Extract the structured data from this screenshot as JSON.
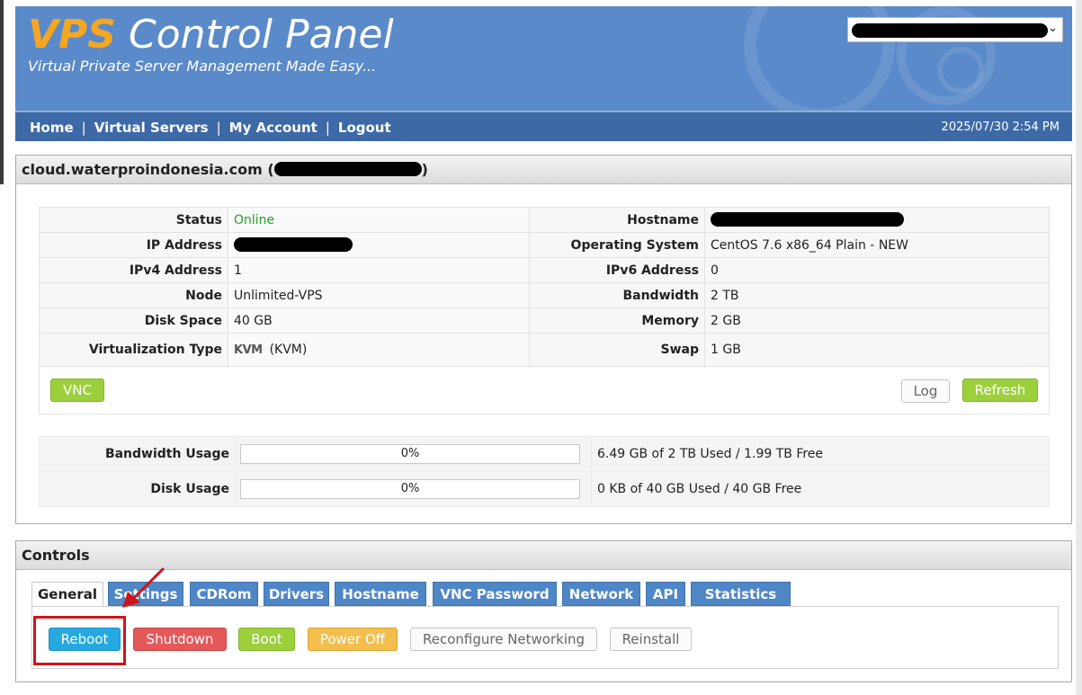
{
  "header": {
    "logo_vps": "VPS",
    "logo_rest": " Control Panel",
    "tagline": "Virtual Private Server Management Made Easy...",
    "server_select_value": ""
  },
  "nav": {
    "home": "Home",
    "virtual_servers": "Virtual Servers",
    "my_account": "My Account",
    "logout": "Logout",
    "separator": "|",
    "datetime": "2025/07/30 2:54 PM"
  },
  "server_panel": {
    "title": "cloud.waterproindonesia.com",
    "open_paren": " (",
    "close_paren": ")"
  },
  "info": {
    "status_label": "Status",
    "status_value": "Online",
    "hostname_label": "Hostname",
    "ip_label": "IP Address",
    "os_label": "Operating System",
    "os_value": "CentOS 7.6 x86_64 Plain - NEW",
    "ipv4_label": "IPv4 Address",
    "ipv4_value": "1",
    "ipv6_label": "IPv6 Address",
    "ipv6_value": "0",
    "node_label": "Node",
    "node_value": "Unlimited-VPS",
    "bandwidth_label": "Bandwidth",
    "bandwidth_value": "2 TB",
    "disk_label": "Disk Space",
    "disk_value": "40 GB",
    "memory_label": "Memory",
    "memory_value": "2 GB",
    "virt_label": "Virtualization Type",
    "virt_logo": "KVM",
    "virt_value": "(KVM)",
    "swap_label": "Swap",
    "swap_value": "1 GB"
  },
  "buttons": {
    "vnc": "VNC",
    "log": "Log",
    "refresh": "Refresh"
  },
  "usage": {
    "bandwidth_label": "Bandwidth Usage",
    "bandwidth_percent": "0%",
    "bandwidth_fraction": 0,
    "bandwidth_text": "6.49 GB of 2 TB Used / 1.99 TB Free",
    "disk_label": "Disk Usage",
    "disk_percent": "0%",
    "disk_fraction": 0,
    "disk_text": "0 KB of 40 GB Used / 40 GB Free"
  },
  "controls": {
    "title": "Controls",
    "tabs": [
      "General",
      "Settings",
      "CDRom",
      "Drivers",
      "Hostname",
      "VNC Password",
      "Network",
      "API",
      "Statistics"
    ],
    "active_tab": "General",
    "actions": {
      "reboot": "Reboot",
      "shutdown": "Shutdown",
      "boot": "Boot",
      "power_off": "Power Off",
      "reconfigure": "Reconfigure Networking",
      "reinstall": "Reinstall"
    }
  },
  "colors": {
    "header_bg": "#5a8ac9",
    "nav_bg": "#3d6aa6",
    "logo_accent": "#f5a623",
    "online": "#2a9d2a",
    "annotation": "#d0131b"
  }
}
